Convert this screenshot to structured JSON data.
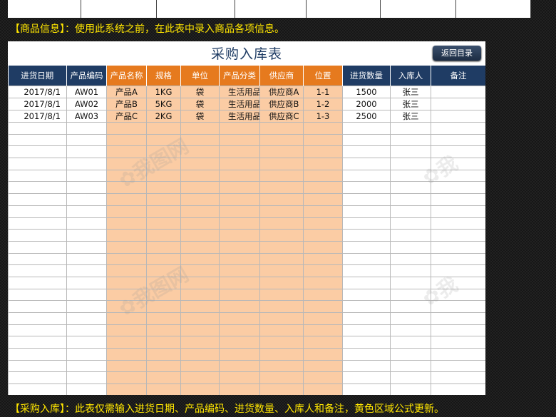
{
  "banners": {
    "product_info": "【商品信息】：使用此系统之前，在此表中录入商品各项信息。",
    "purchase_in": "【采购入库】：此表仅需输入进货日期、产品编码、进货数量、入库人和备注，黄色区域公式更新。"
  },
  "sheet": {
    "title": "采购入库表",
    "back_button": "返回目录",
    "headers": [
      "进货日期",
      "产品编码",
      "产品名称",
      "规格",
      "单位",
      "产品分类",
      "供应商",
      "位置",
      "进货数量",
      "入库人",
      "备注"
    ],
    "rows": [
      [
        "2017/8/1",
        "AW01",
        "产品A",
        "1KG",
        "袋",
        "生活用品",
        "供应商A",
        "1-1",
        "1500",
        "张三",
        ""
      ],
      [
        "2017/8/1",
        "AW02",
        "产品B",
        "5KG",
        "袋",
        "生活用品",
        "供应商B",
        "1-2",
        "2000",
        "张三",
        ""
      ],
      [
        "2017/8/1",
        "AW03",
        "产品C",
        "2KG",
        "袋",
        "生活用品",
        "供应商C",
        "1-3",
        "2500",
        "张三",
        ""
      ]
    ]
  },
  "colors": {
    "header_blue": "#1f3c64",
    "header_orange": "#e67a1e",
    "formula_fill": "#fbcca4",
    "banner_text": "#ffe600"
  }
}
